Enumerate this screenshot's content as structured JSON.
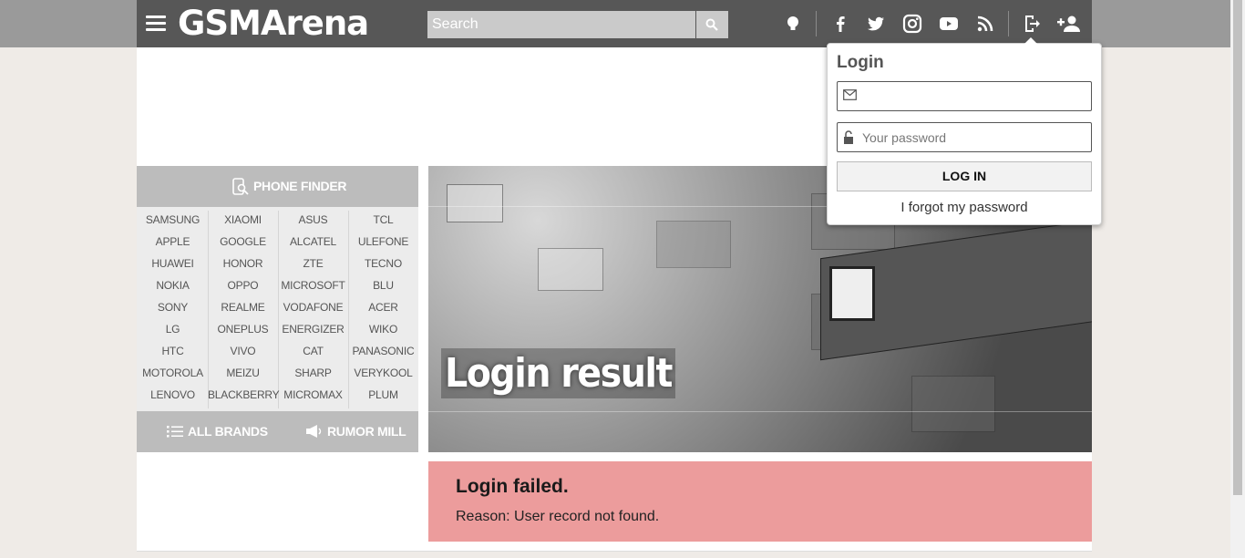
{
  "header": {
    "logo": "GSMArena",
    "search_placeholder": "Search",
    "icons": [
      "menu-icon",
      "search-icon",
      "lightbulb-icon",
      "facebook-icon",
      "twitter-icon",
      "instagram-icon",
      "youtube-icon",
      "rss-icon",
      "login-icon",
      "add-user-icon"
    ]
  },
  "phone_finder": {
    "title": "PHONE FINDER",
    "brands": [
      [
        "SAMSUNG",
        "XIAOMI",
        "ASUS",
        "TCL"
      ],
      [
        "APPLE",
        "GOOGLE",
        "ALCATEL",
        "ULEFONE"
      ],
      [
        "HUAWEI",
        "HONOR",
        "ZTE",
        "TECNO"
      ],
      [
        "NOKIA",
        "OPPO",
        "MICROSOFT",
        "BLU"
      ],
      [
        "SONY",
        "REALME",
        "VODAFONE",
        "ACER"
      ],
      [
        "LG",
        "ONEPLUS",
        "ENERGIZER",
        "WIKO"
      ],
      [
        "HTC",
        "VIVO",
        "CAT",
        "PANASONIC"
      ],
      [
        "MOTOROLA",
        "MEIZU",
        "SHARP",
        "VERYKOOL"
      ],
      [
        "LENOVO",
        "BLACKBERRY",
        "MICROMAX",
        "PLUM"
      ]
    ],
    "all_brands": "ALL BRANDS",
    "rumor_mill": "RUMOR MILL"
  },
  "hero": {
    "title": "Login result"
  },
  "alert": {
    "title": "Login failed.",
    "reason": "Reason: User record not found."
  },
  "login_popup": {
    "title": "Login",
    "email_value": "",
    "password_placeholder": "Your password",
    "button": "LOG IN",
    "forgot": "I forgot my password"
  },
  "colors": {
    "header_bg": "#575757",
    "alert_bg": "#ec9c9c",
    "finder_bg": "#ececec"
  }
}
